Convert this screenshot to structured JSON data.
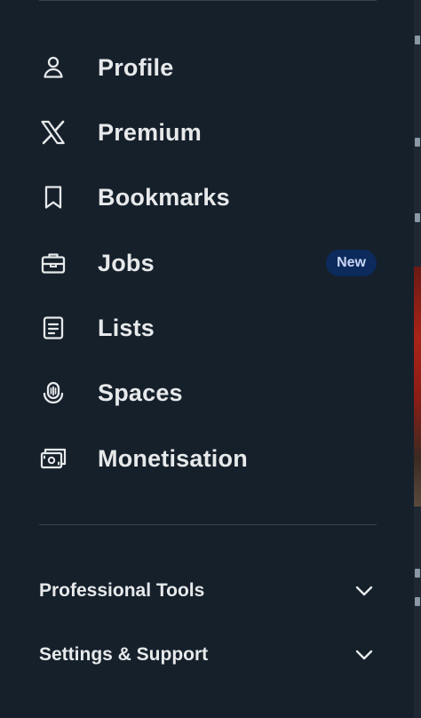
{
  "menu": {
    "items": [
      {
        "label": "Profile",
        "icon": "person-icon"
      },
      {
        "label": "Premium",
        "icon": "x-logo-icon"
      },
      {
        "label": "Bookmarks",
        "icon": "bookmark-icon"
      },
      {
        "label": "Jobs",
        "icon": "briefcase-icon",
        "badge": "New"
      },
      {
        "label": "Lists",
        "icon": "list-document-icon"
      },
      {
        "label": "Spaces",
        "icon": "microphone-spaces-icon"
      },
      {
        "label": "Monetisation",
        "icon": "money-icon"
      }
    ]
  },
  "sections": [
    {
      "label": "Professional Tools",
      "icon": "chevron-down-icon"
    },
    {
      "label": "Settings & Support",
      "icon": "chevron-down-icon"
    }
  ],
  "colors": {
    "background": "#15202b",
    "text": "#e7e9ea",
    "divider": "#38444d",
    "badge_bg": "#0c2a5c",
    "badge_text": "#c9d6f5"
  }
}
